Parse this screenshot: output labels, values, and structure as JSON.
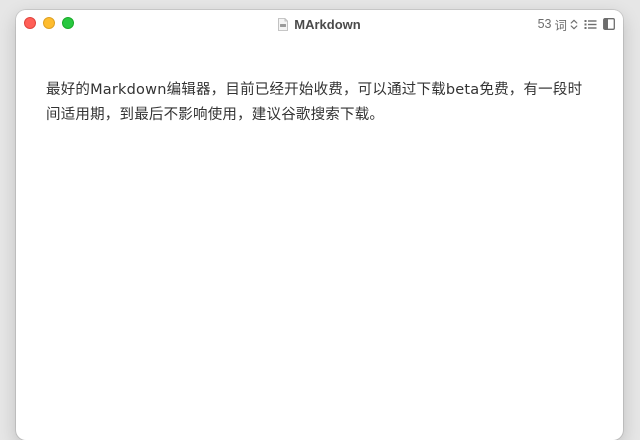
{
  "window": {
    "title": "MArkdown",
    "word_count": {
      "number": "53",
      "unit": "词"
    }
  },
  "editor": {
    "content": "最好的Markdown编辑器，目前已经开始收费，可以通过下载beta免费，有一段时间适用期，到最后不影响使用，建议谷歌搜索下载。"
  },
  "icons": {
    "document": "document-icon",
    "updown": "chevron-updown-icon",
    "outline": "list-outline-icon",
    "sidebar": "sidebar-toggle-icon"
  },
  "colors": {
    "close": "#ff5f57",
    "minimize": "#febc2e",
    "maximize": "#28c840",
    "text": "#333333"
  }
}
